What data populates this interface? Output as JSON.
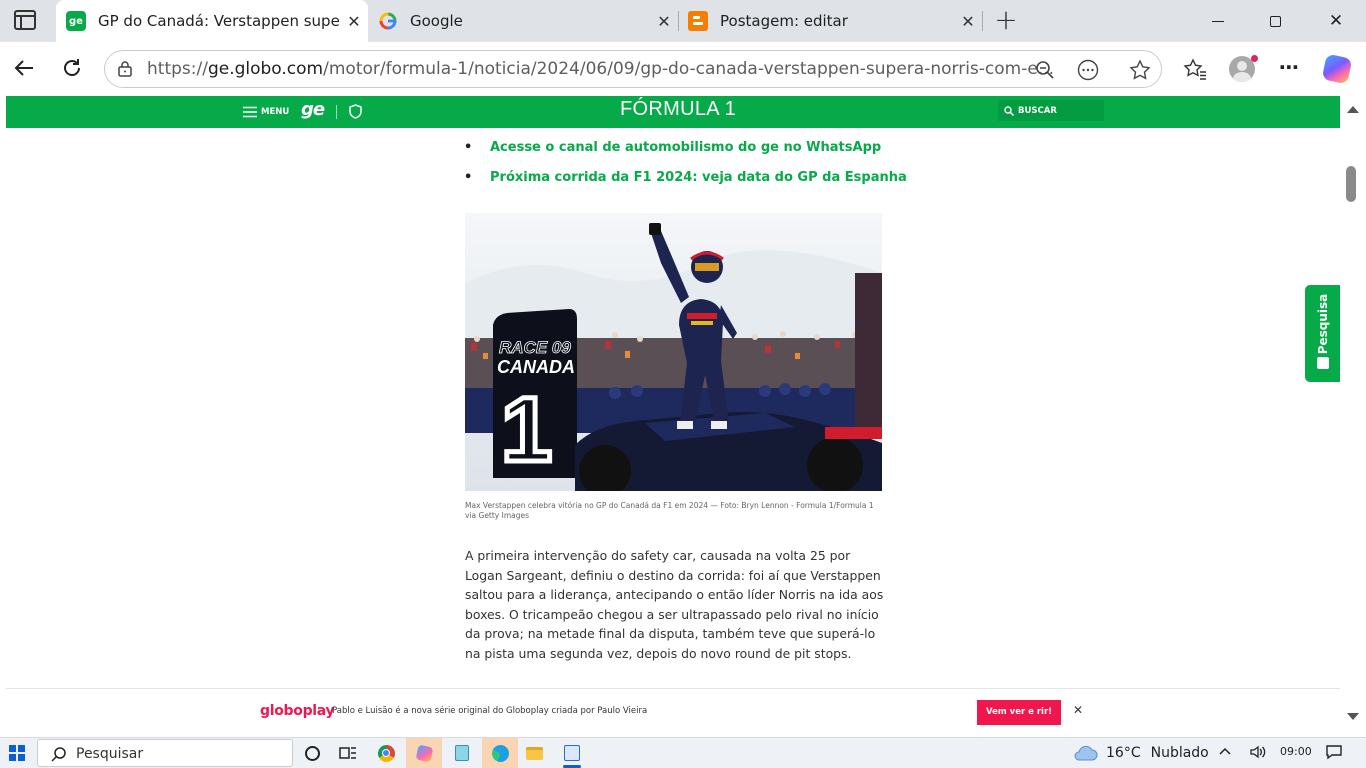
{
  "browser": {
    "tabs": [
      {
        "title": "GP do Canadá: Verstappen supera Norris com estratégia",
        "favicon": "ge-icon",
        "active": true
      },
      {
        "title": "Google",
        "favicon": "google-icon",
        "active": false
      },
      {
        "title": "Postagem: editar",
        "favicon": "blogger-icon",
        "active": false
      }
    ],
    "url_scheme": "https://",
    "url_domain": "ge.globo.com",
    "url_path": "/motor/formula-1/noticia/2024/06/09/gp-do-canada-verstappen-supera-norris-com-e...",
    "new_tab_symbol": "+",
    "close_symbol": "✕"
  },
  "site_header": {
    "menu_label": "MENU",
    "logo": "ge",
    "section_title": "FÓRMULA 1",
    "search_label": "BUSCAR",
    "accent": "#06aa48"
  },
  "article": {
    "links": [
      "Acesse o canal de automobilismo do ge no WhatsApp",
      "Próxima corrida da F1 2024: veja data do GP da Espanha"
    ],
    "photo_sign_race": "RACE 09",
    "photo_sign_country": "CANADA",
    "photo_sign_position": "1",
    "caption": "Max Verstappen celebra vitória no GP do Canadá da F1 em 2024 — Foto: Bryn Lennon - Formula 1/Formula 1 via Getty Images",
    "paragraph": "A primeira intervenção do safety car, causada na volta 25 por Logan Sargeant, definiu o destino da corrida: foi aí que Verstappen saltou para a liderança, antecipando o então líder Norris na ida aos boxes. O tricampeão chegou a ser ultrapassado pelo rival no início da prova; na metade final da disputa, também teve que superá-lo na pista uma segunda vez, depois do novo round de pit stops."
  },
  "side_widget": {
    "label": "Pesquisa"
  },
  "banner": {
    "brand": "globoplay",
    "text": "Pablo e Luisão é a nova série original do Globoplay criada por Paulo Vieira",
    "button": "Vem ver e rir!",
    "button_color": "#f0174f",
    "close": "✕"
  },
  "taskbar": {
    "search_placeholder": "Pesquisar",
    "temperature": "16°C",
    "weather": "Nublado",
    "time": "09:00"
  }
}
